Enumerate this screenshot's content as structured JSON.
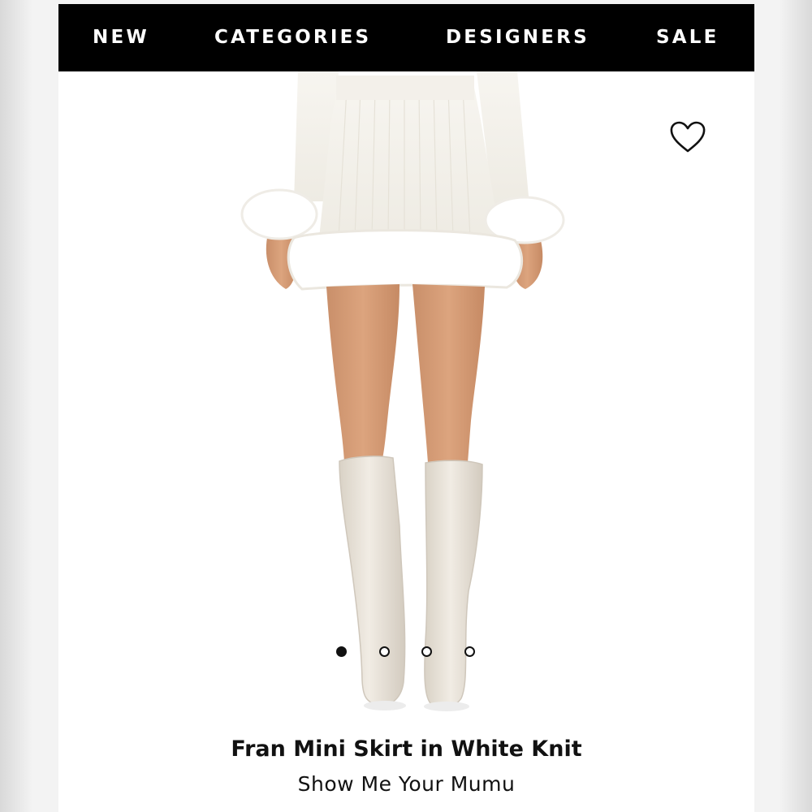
{
  "nav": {
    "items": [
      {
        "label": "NEW"
      },
      {
        "label": "CATEGORIES"
      },
      {
        "label": "DESIGNERS"
      },
      {
        "label": "SALE"
      }
    ]
  },
  "product": {
    "name": "Fran Mini Skirt in White Knit",
    "brand": "Show Me Your Mumu",
    "wishlist_icon": "heart-outline-icon"
  },
  "gallery": {
    "image_count": 4,
    "active_index": 0
  },
  "colors": {
    "nav_background": "#000000",
    "nav_text": "#ffffff",
    "page_background": "#ffffff",
    "text": "#111111"
  }
}
